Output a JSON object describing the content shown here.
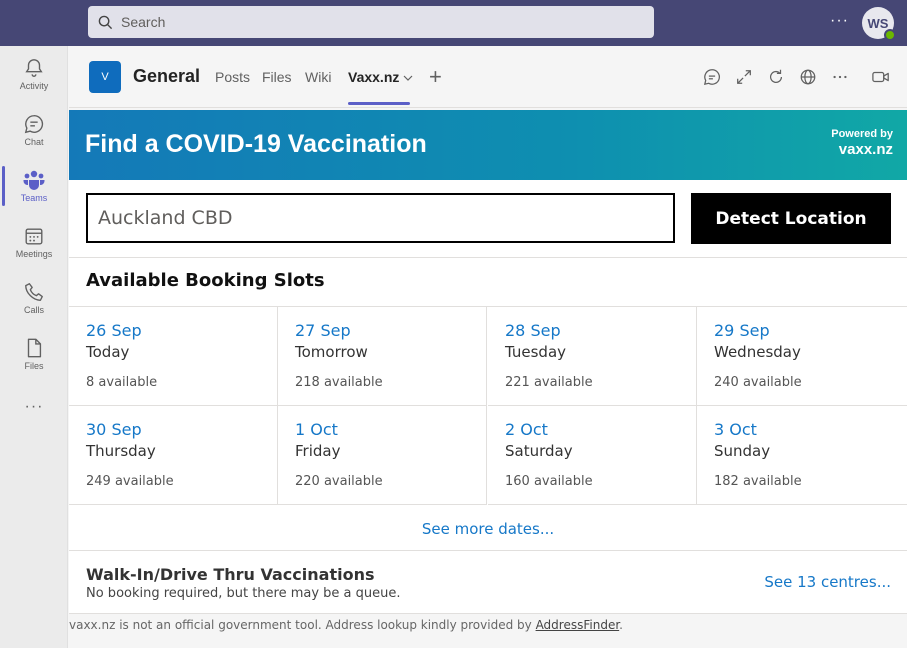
{
  "topbar": {
    "search_placeholder": "Search",
    "avatar_initials": "WS",
    "more": "···"
  },
  "rail": {
    "items": [
      {
        "label": "Activity",
        "icon": "bell-icon"
      },
      {
        "label": "Chat",
        "icon": "chat-icon"
      },
      {
        "label": "Teams",
        "icon": "teams-icon"
      },
      {
        "label": "Meetings",
        "icon": "calendar-icon"
      },
      {
        "label": "Calls",
        "icon": "phone-icon"
      },
      {
        "label": "Files",
        "icon": "file-icon"
      }
    ],
    "more": "···"
  },
  "channel": {
    "team_initial": "V",
    "name": "General",
    "tabs": [
      "Posts",
      "Files",
      "Wiki",
      "Vaxx.nz"
    ],
    "active_tab": "Vaxx.nz",
    "add": "+"
  },
  "app": {
    "title": "Find a COVID-19 Vaccination",
    "powered_label": "Powered by",
    "powered_brand": "vaxx.nz",
    "location_placeholder": "Auckland CBD",
    "detect_label": "Detect Location",
    "slots_heading": "Available Booking Slots",
    "slots": [
      {
        "date": "26 Sep",
        "day": "Today",
        "available": "8 available"
      },
      {
        "date": "27 Sep",
        "day": "Tomorrow",
        "available": "218 available"
      },
      {
        "date": "28 Sep",
        "day": "Tuesday",
        "available": "221 available"
      },
      {
        "date": "29 Sep",
        "day": "Wednesday",
        "available": "240 available"
      },
      {
        "date": "30 Sep",
        "day": "Thursday",
        "available": "249 available"
      },
      {
        "date": "1 Oct",
        "day": "Friday",
        "available": "220 available"
      },
      {
        "date": "2 Oct",
        "day": "Saturday",
        "available": "160 available"
      },
      {
        "date": "3 Oct",
        "day": "Sunday",
        "available": "182 available"
      }
    ],
    "see_more": "See more dates...",
    "walkin_title": "Walk-In/Drive Thru Vaccinations",
    "walkin_sub": "No booking required, but there may be a queue.",
    "walkin_link": "See 13 centres...",
    "footer_text": "vaxx.nz is not an official government tool. Address lookup kindly provided by ",
    "footer_link": "AddressFinder",
    "footer_end": "."
  },
  "colors": {
    "teams_header": "#464775",
    "accent": "#5b5fc7",
    "link": "#1678c8"
  }
}
